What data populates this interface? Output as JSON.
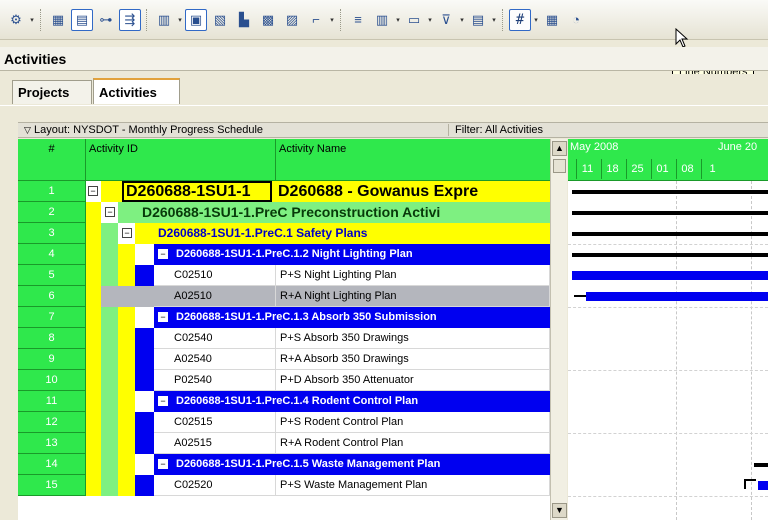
{
  "toolbar": {
    "buttons": [
      {
        "icon": "assign-icon",
        "glyph": "⚙",
        "dropdown": true
      },
      {
        "icon": "table-view-icon",
        "glyph": "▦"
      },
      {
        "icon": "gantt-view-icon",
        "glyph": "▤",
        "active": true
      },
      {
        "icon": "network-icon",
        "glyph": "⊶"
      },
      {
        "icon": "relationship-icon",
        "glyph": "⇶",
        "active": true
      },
      {
        "icon": "histogram-icon",
        "glyph": "▥",
        "dropdown": true
      },
      {
        "icon": "details-icon",
        "glyph": "▣",
        "active": true
      },
      {
        "icon": "layout-icon",
        "glyph": "▧"
      },
      {
        "icon": "chart-icon",
        "glyph": "▙"
      },
      {
        "icon": "usage-icon",
        "glyph": "▩"
      },
      {
        "icon": "profile-icon",
        "glyph": "▨"
      },
      {
        "icon": "trace-icon",
        "glyph": "⌐",
        "dropdown": true
      },
      {
        "icon": "group-sort-icon",
        "glyph": "≡"
      },
      {
        "icon": "columns-icon",
        "glyph": "▥",
        "dropdown": true
      },
      {
        "icon": "bars-icon",
        "glyph": "▭",
        "dropdown": true
      },
      {
        "icon": "filter-icon",
        "glyph": "⊽",
        "dropdown": true
      },
      {
        "icon": "collapse-icon",
        "glyph": "▤",
        "dropdown": true
      },
      {
        "icon": "line-numbers-icon",
        "glyph": "#",
        "hash": true,
        "dropdown": true
      },
      {
        "icon": "summary-icon",
        "glyph": "▦"
      },
      {
        "icon": "schedule-icon",
        "glyph": "◔"
      }
    ],
    "tooltip": "Line Numbers"
  },
  "window": {
    "title": "Activities"
  },
  "tabs": [
    {
      "label": "Projects",
      "active": false
    },
    {
      "label": "Activities",
      "active": true
    }
  ],
  "layoutbar": {
    "layout": "Layout: NYSDOT - Monthly Progress Schedule",
    "filter": "Filter: All Activities"
  },
  "columns": {
    "num": "#",
    "id": "Activity ID",
    "name": "Activity Name"
  },
  "colors": {
    "green": "#2fe84c",
    "yellow": "#ffff00",
    "lightgreen": "#7ef081",
    "blue": "#0000f0",
    "selected": "#b4b6bd"
  },
  "rows": [
    {
      "n": "1",
      "type": "wbs0",
      "id": "D260688-1SU1-1",
      "name": "D260688 - Gowanus Expre"
    },
    {
      "n": "2",
      "type": "wbs1",
      "text": "D260688-1SU1-1.PreC  Preconstruction Activi"
    },
    {
      "n": "3",
      "type": "wbs2",
      "text": "D260688-1SU1-1.PreC.1  Safety Plans"
    },
    {
      "n": "4",
      "type": "wbs3",
      "text": "D260688-1SU1-1.PreC.1.2  Night Lighting Plan"
    },
    {
      "n": "5",
      "type": "act",
      "id": "C02510",
      "name": "P+S Night Lighting Plan"
    },
    {
      "n": "6",
      "type": "act",
      "id": "A02510",
      "name": "R+A Night Lighting Plan",
      "selected": true
    },
    {
      "n": "7",
      "type": "wbs3",
      "text": "D260688-1SU1-1.PreC.1.3  Absorb 350 Submission"
    },
    {
      "n": "8",
      "type": "act",
      "id": "C02540",
      "name": "P+S Absorb 350 Drawings"
    },
    {
      "n": "9",
      "type": "act",
      "id": "A02540",
      "name": "R+A Absorb 350 Drawings"
    },
    {
      "n": "10",
      "type": "act",
      "id": "P02540",
      "name": "P+D Absorb 350 Attenuator"
    },
    {
      "n": "11",
      "type": "wbs3",
      "text": "D260688-1SU1-1.PreC.1.4  Rodent Control Plan"
    },
    {
      "n": "12",
      "type": "act",
      "id": "C02515",
      "name": "P+S Rodent Control Plan"
    },
    {
      "n": "13",
      "type": "act",
      "id": "A02515",
      "name": "R+A Rodent Control Plan"
    },
    {
      "n": "14",
      "type": "wbs3",
      "text": "D260688-1SU1-1.PreC.1.5  Waste Management Plan"
    },
    {
      "n": "15",
      "type": "act",
      "id": "C02520",
      "name": "P+S Waste Management Plan"
    }
  ],
  "gantt": {
    "months": [
      {
        "label": "May 2008"
      },
      {
        "label": "June 20"
      }
    ],
    "weeks": [
      "11",
      "18",
      "25",
      "01",
      "08",
      "1"
    ]
  }
}
